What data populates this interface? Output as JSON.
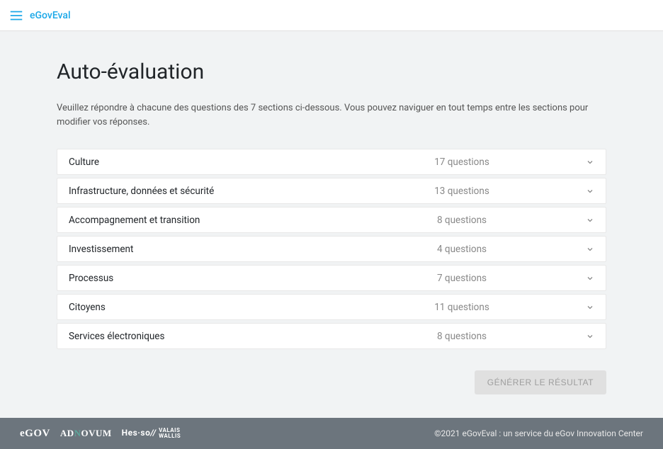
{
  "header": {
    "app_title": "eGovEval"
  },
  "main": {
    "page_title": "Auto-évaluation",
    "description": "Veuillez répondre à chacune des questions des 7 sections ci-dessous. Vous pouvez naviguer en tout temps entre les sections pour modifier vos réponses.",
    "sections": [
      {
        "label": "Culture",
        "count": "17 questions"
      },
      {
        "label": "Infrastructure, données et sécurité",
        "count": "13 questions"
      },
      {
        "label": "Accompagnement et transition",
        "count": "8 questions"
      },
      {
        "label": "Investissement",
        "count": "4 questions"
      },
      {
        "label": "Processus",
        "count": "7 questions"
      },
      {
        "label": "Citoyens",
        "count": "11 questions"
      },
      {
        "label": "Services électroniques",
        "count": "8 questions"
      }
    ],
    "generate_label": "GÉNÉRER LE RÉSULTAT"
  },
  "footer": {
    "logo_egov": "eGOV",
    "logo_adnovum_a": "A",
    "logo_adnovum_d": "D",
    "logo_adnovum_n": "N",
    "logo_adnovum_rest": "OVUM",
    "logo_hesso": "Hes·so",
    "logo_valais_line1": "VALAIS",
    "logo_valais_line2": "WALLIS",
    "copyright": "©2021 eGovEval : un service du eGov Innovation Center"
  }
}
